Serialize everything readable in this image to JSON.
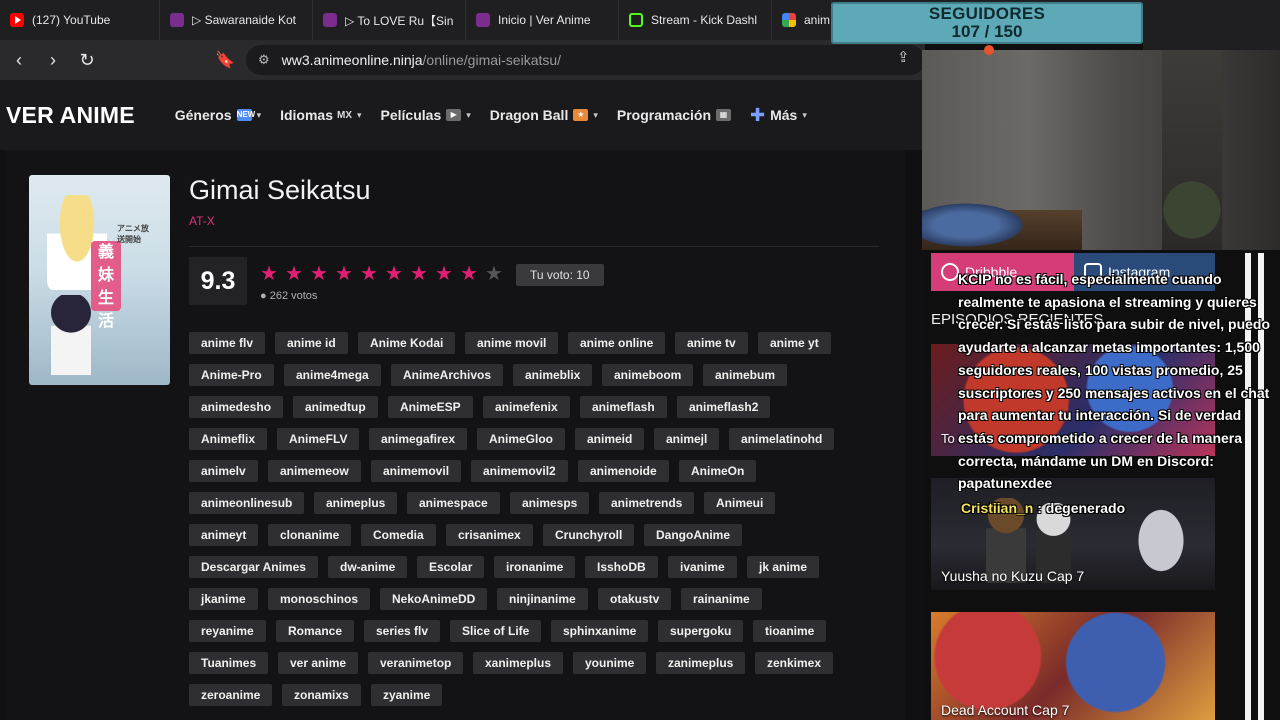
{
  "browser": {
    "tabs": [
      {
        "title": "(127) YouTube",
        "icon": "youtube-icon"
      },
      {
        "title": "▷ Sawaranaide Kot",
        "icon": "anime-site-icon"
      },
      {
        "title": "▷ To LOVE Ru【Sin",
        "icon": "anime-site-icon"
      },
      {
        "title": "Inicio | Ver Anime",
        "icon": "anime-site-icon"
      },
      {
        "title": "Stream - Kick Dashl",
        "icon": "kick-icon"
      },
      {
        "title": "anim",
        "icon": "google-icon"
      }
    ],
    "url_host": "ww3.animeonline.ninja",
    "url_path": "/online/gimai-seikatsu/"
  },
  "site": {
    "logo": "VER ANIME",
    "menu": [
      {
        "label": "Géneros",
        "badge": "🆕",
        "caret": "▾"
      },
      {
        "label": "Idiomas",
        "badge": "MX",
        "caret": "▾"
      },
      {
        "label": "Películas",
        "badge": "🎥",
        "caret": "▾"
      },
      {
        "label": "Dragon Ball",
        "badge": "🔶",
        "caret": "▾"
      },
      {
        "label": "Programación",
        "badge": "📅",
        "caret": ""
      },
      {
        "label": "Más",
        "badge": "",
        "caret": "▾"
      }
    ]
  },
  "anime": {
    "title": "Gimai Seikatsu",
    "studio": "AT-X",
    "score": "9.3",
    "stars_filled": 9,
    "stars_total": 10,
    "votes": "262 votos",
    "your_vote": "Tu voto: 10",
    "poster_kanji": "義妹生活",
    "poster_caption": "アニメ放送開始"
  },
  "tags": [
    [
      "anime flv",
      "anime id",
      "Anime Kodai",
      "anime movil",
      "anime online",
      "anime tv",
      "anime yt"
    ],
    [
      "Anime-Pro",
      "anime4mega",
      "AnimeArchivos",
      "animeblix",
      "animeboom",
      "animebum"
    ],
    [
      "animedesho",
      "animedtup",
      "AnimeESP",
      "animefenix",
      "animeflash",
      "animeflash2"
    ],
    [
      "Animeflix",
      "AnimeFLV",
      "animegafirex",
      "AnimeGloo",
      "animeid",
      "animejl",
      "animelatinohd"
    ],
    [
      "animelv",
      "animemeow",
      "animemovil",
      "animemovil2",
      "animenoide",
      "AnimeOn"
    ],
    [
      "animeonlinesub",
      "animeplus",
      "animespace",
      "animesps",
      "animetrends",
      "Animeui"
    ],
    [
      "animeyt",
      "clonanime",
      "Comedia",
      "crisanimex",
      "Crunchyroll",
      "DangoAnime"
    ],
    [
      "Descargar Animes",
      "dw-anime",
      "Escolar",
      "ironanime",
      "IsshoDB",
      "ivanime",
      "jk anime"
    ],
    [
      "jkanime",
      "monoschinos",
      "NekoAnimeDD",
      "ninjinanime",
      "otakustv",
      "rainanime"
    ],
    [
      "reyanime",
      "Romance",
      "series flv",
      "Slice of Life",
      "sphinxanime",
      "supergoku",
      "tioanime"
    ],
    [
      "Tuanimes",
      "ver anime",
      "veranimetop",
      "xanimeplus",
      "younime",
      "zanimeplus",
      "zenkimex"
    ],
    [
      "zeroanime",
      "zonamixs",
      "zyanime"
    ]
  ],
  "sidebar": {
    "dribbble": "Dribbble",
    "instagram": "Instagram",
    "recent_title": "EPISODIOS RECIENTES",
    "episodes": [
      {
        "label": "To"
      },
      {
        "label": "Yuusha no Kuzu Cap 7"
      },
      {
        "label": "Dead Account Cap 7"
      }
    ]
  },
  "overlay": {
    "followers_label": "SEGUIDORES",
    "followers_count": "107 / 150",
    "chat_message_lines": [
      "KCIP no es fácil, especialmente cuando",
      "realmente te apasiona el streaming y quieres",
      "crecer. Si estás listo para subir de nivel, puedo",
      "ayudarte a alcanzar metas importantes: 1,500",
      "seguidores reales, 100 vistas promedio, 25",
      "suscriptores y 250 mensajes activos en el chat",
      "para aumentar tu interacción. Si de verdad",
      "estás comprometido a crecer de la manera",
      "correcta, mándame un DM en Discord:",
      "papatunexdee"
    ],
    "chat2_user": "Cristiian_n",
    "chat2_text": " : degenerado"
  }
}
